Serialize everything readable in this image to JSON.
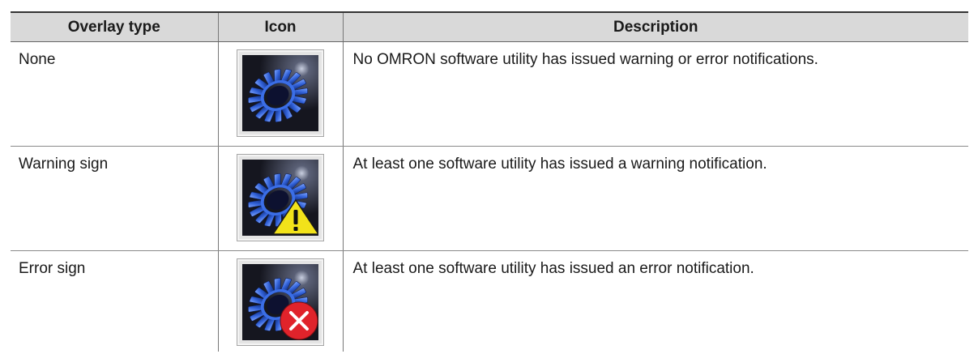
{
  "table": {
    "headers": {
      "overlay_type": "Overlay type",
      "icon": "Icon",
      "description": "Description"
    },
    "rows": [
      {
        "overlay_type": "None",
        "icon": "omron-utility-icon",
        "description": "No OMRON software utility has issued warning or error notifications."
      },
      {
        "overlay_type": "Warning sign",
        "icon": "omron-utility-warning-icon",
        "description": "At least one software utility has issued a warning notification."
      },
      {
        "overlay_type": "Error sign",
        "icon": "omron-utility-error-icon",
        "description": "At least one software utility has issued an error notification."
      }
    ]
  },
  "colors": {
    "header_background": "#d9d9d9",
    "icon_background": "#15161f",
    "gear_blue": "#2f5fd6",
    "warning_yellow": "#f2e21a",
    "error_red": "#e0232b"
  }
}
